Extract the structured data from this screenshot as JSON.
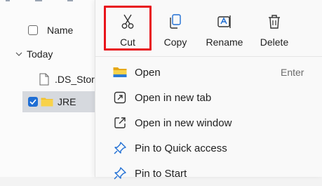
{
  "explorer": {
    "header_name": "Name",
    "group_label": "Today",
    "files": [
      {
        "name": ".DS_Store"
      },
      {
        "name": "JRE",
        "selected": true
      }
    ]
  },
  "context_menu": {
    "toolbar": [
      {
        "label": "Cut",
        "icon": "scissors-icon",
        "highlighted": true
      },
      {
        "label": "Copy",
        "icon": "copy-icon"
      },
      {
        "label": "Rename",
        "icon": "rename-icon"
      },
      {
        "label": "Delete",
        "icon": "trash-icon"
      }
    ],
    "items": [
      {
        "label": "Open",
        "icon": "folder-icon",
        "shortcut": "Enter"
      },
      {
        "label": "Open in new tab",
        "icon": "new-tab-icon"
      },
      {
        "label": "Open in new window",
        "icon": "new-window-icon"
      },
      {
        "label": "Pin to Quick access",
        "icon": "pin-icon"
      },
      {
        "label": "Pin to Start",
        "icon": "pin-icon"
      }
    ]
  },
  "colors": {
    "highlight": "#e8141b",
    "accent": "#1f6ed4",
    "folder": "#f2c230"
  }
}
